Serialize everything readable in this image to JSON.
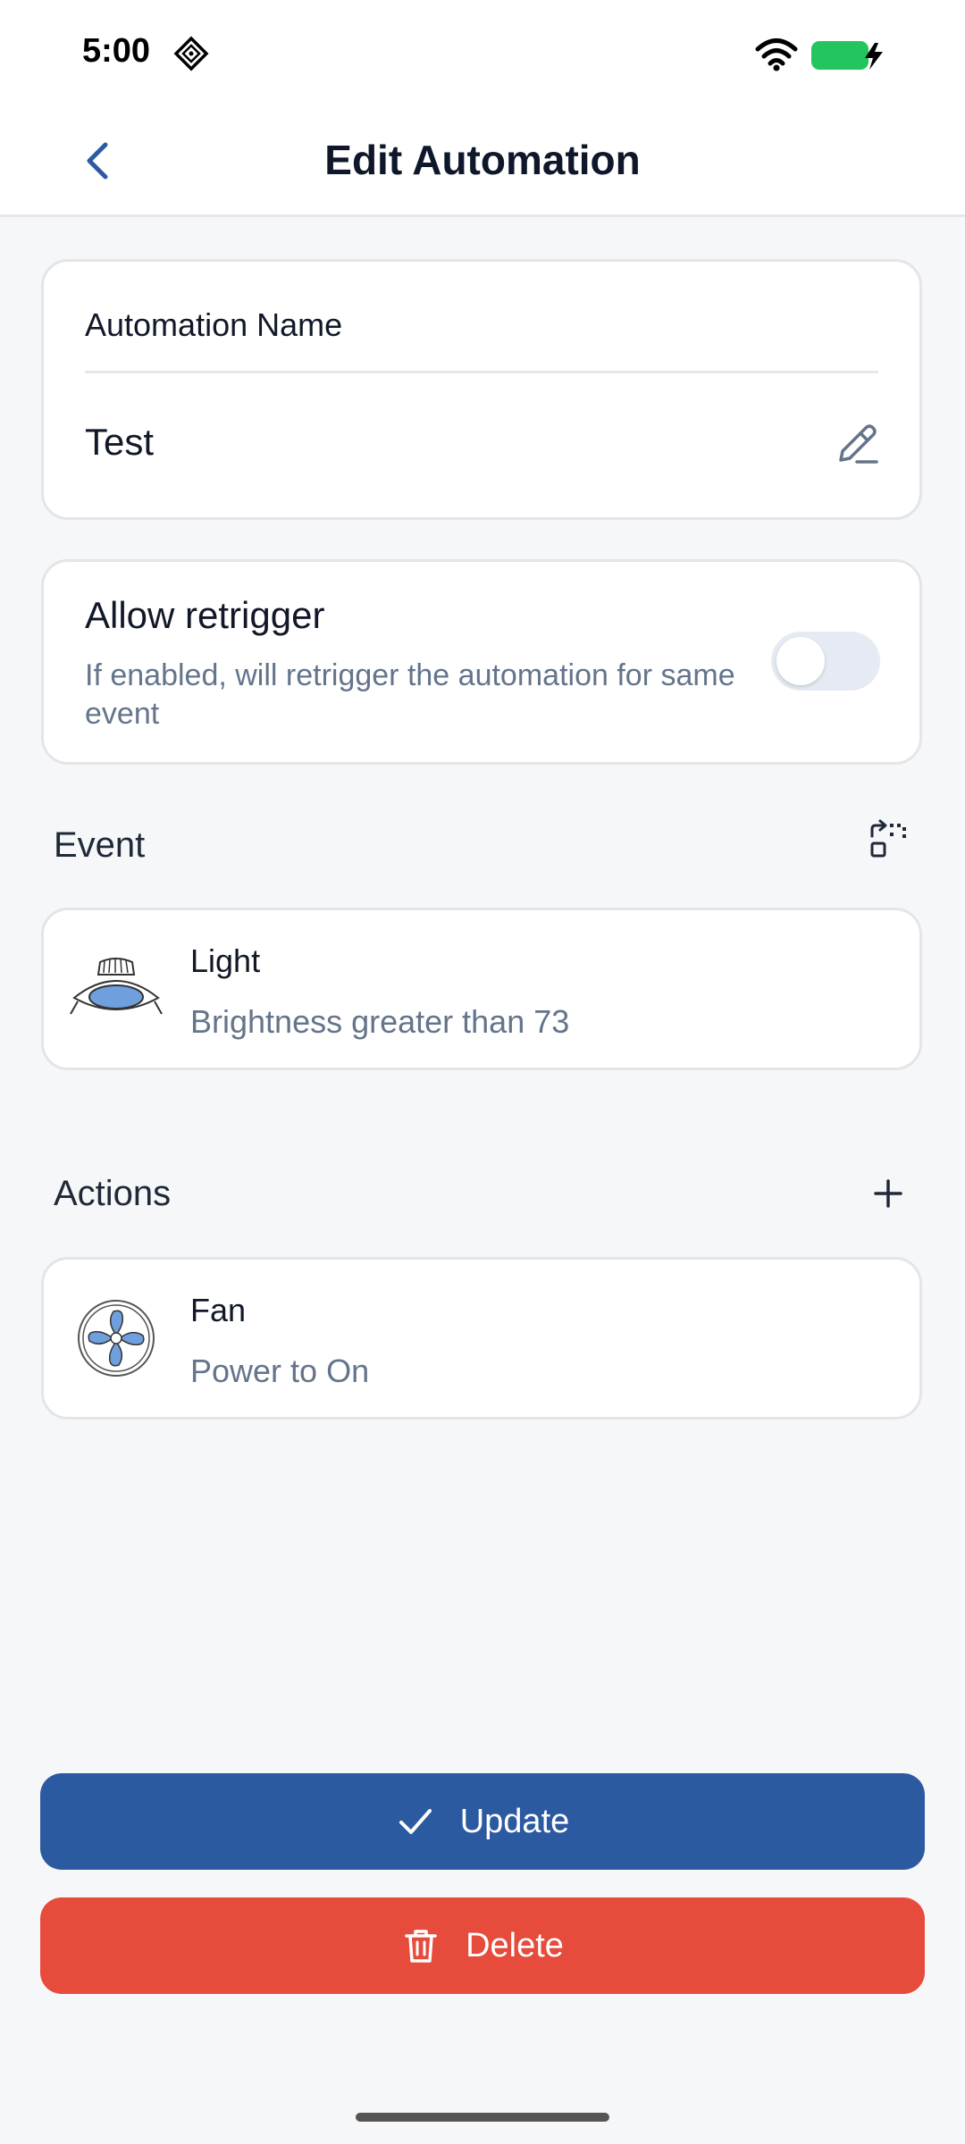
{
  "status_bar": {
    "time": "5:00"
  },
  "header": {
    "title": "Edit Automation",
    "back_icon": "chevron-left-icon"
  },
  "name_card": {
    "label": "Automation Name",
    "value": "Test",
    "edit_icon": "pencil-icon"
  },
  "retrigger": {
    "title": "Allow retrigger",
    "description": "If enabled, will retrigger the automation for same event",
    "enabled": false
  },
  "event_section": {
    "title": "Event",
    "icon": "change-event-icon",
    "item": {
      "name": "Light",
      "detail": "Brightness greater than 73",
      "icon": "light-icon"
    }
  },
  "actions_section": {
    "title": "Actions",
    "icon": "plus-icon",
    "items": [
      {
        "name": "Fan",
        "detail": "Power to On",
        "icon": "fan-icon"
      }
    ]
  },
  "buttons": {
    "update_label": "Update",
    "delete_label": "Delete"
  },
  "colors": {
    "primary": "#2c5aa0",
    "danger": "#e64b3c",
    "background": "#f6f7f9",
    "battery": "#22c55e"
  }
}
